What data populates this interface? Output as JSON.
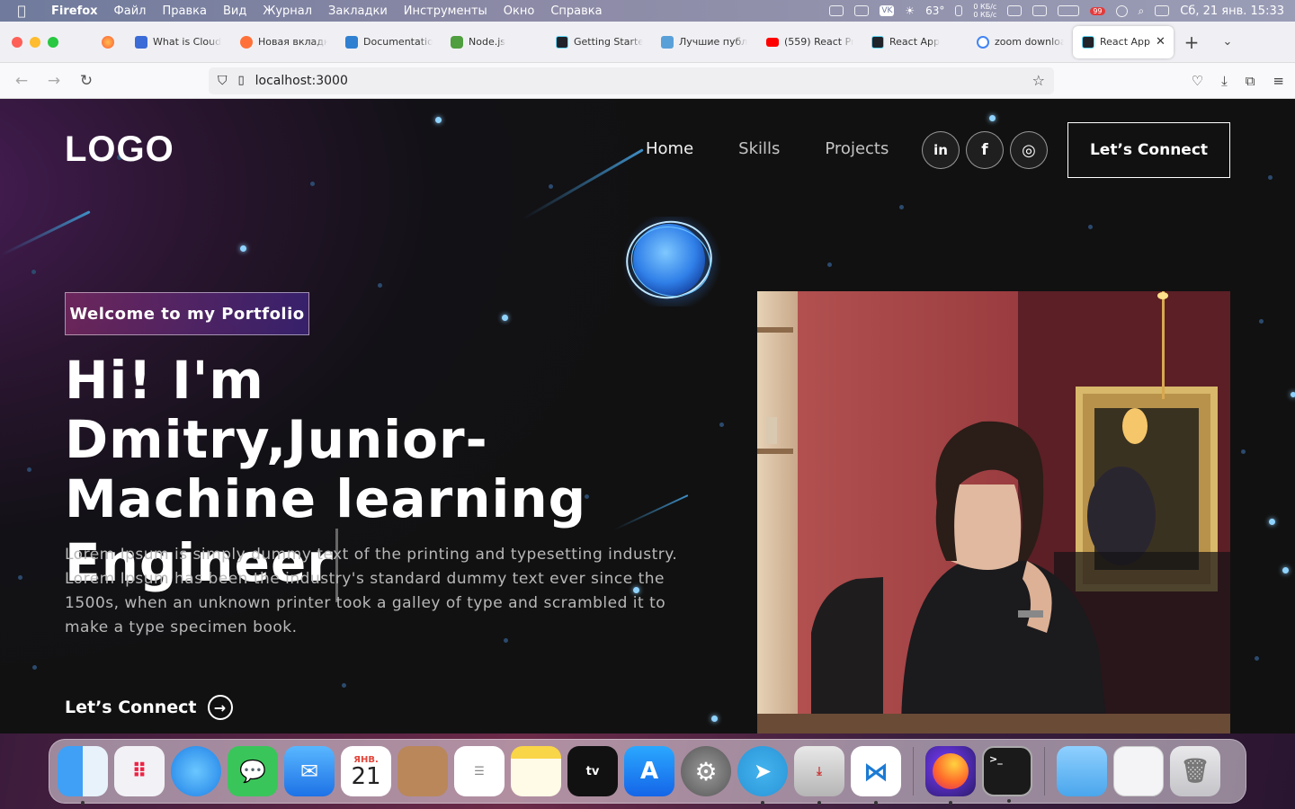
{
  "menubar": {
    "app_name": "Firefox",
    "items": [
      "Файл",
      "Правка",
      "Вид",
      "Журнал",
      "Закладки",
      "Инструменты",
      "Окно",
      "Справка"
    ],
    "weather": "63°",
    "net_up": "0 КБ/с",
    "net_down": "0 КБ/с",
    "badge_count": "99",
    "clock": "Сб, 21 янв.  15:33"
  },
  "tabs": [
    {
      "label": "What is Cloud",
      "color": "#3b6bd6"
    },
    {
      "label": "Новая вкладк",
      "color": "#ff7139"
    },
    {
      "label": "Documentatio",
      "color": "#2f80d1"
    },
    {
      "label": "Node.js",
      "color": "#4f9e3f"
    },
    {
      "label": "Getting Starte",
      "color": "#20232a"
    },
    {
      "label": "Лучшие публ",
      "color": "#5aa0d8"
    },
    {
      "label": "(559) React Pr",
      "color": "#ff0000"
    },
    {
      "label": "React App",
      "color": "#20232a"
    },
    {
      "label": "zoom downloa",
      "color": "#4285f4"
    }
  ],
  "active_tab": {
    "label": "React App",
    "color": "#20232a"
  },
  "url": "localhost:3000",
  "site": {
    "logo": "LOGO",
    "nav": [
      "Home",
      "Skills",
      "Projects"
    ],
    "social": [
      "in",
      "f",
      "◎"
    ],
    "connect_button": "Let’s Connect",
    "badge": "Welcome to my Portfolio",
    "headline": "Hi! I'm Dmitry,Junior-Machine learning Engineer",
    "lead": "Lorem Ipsum is simply dummy text of the printing and typesetting industry. Lorem Ipsum has been the industry's standard dummy text ever since the 1500s, when an unknown printer took a galley of type and scrambled it to make a type specimen book.",
    "cta": "Let’s Connect",
    "cta_arrow": "→"
  },
  "dock": {
    "calendar_month": "ЯНВ.",
    "calendar_day": "21",
    "tv_label": "tv",
    "terminal_label": ">_"
  }
}
